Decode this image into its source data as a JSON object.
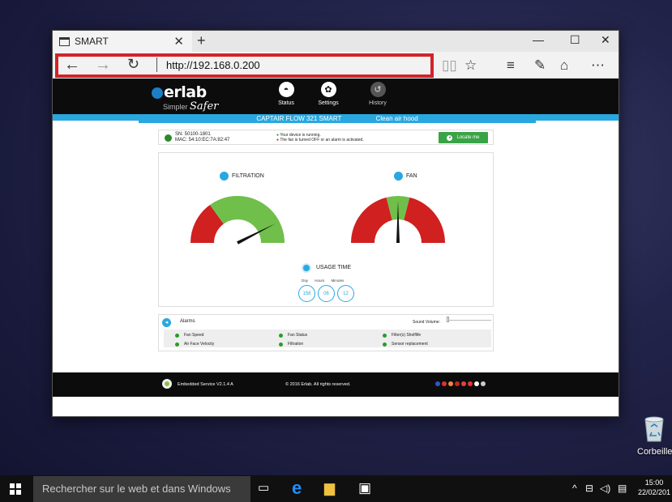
{
  "desktop": {
    "recycle_bin_label": "Corbeille"
  },
  "browser": {
    "tab_title": "SMART",
    "url": "http://192.168.0.200"
  },
  "site": {
    "brand": "erlab",
    "tagline_prefix": "Simpler ",
    "tagline_script": "Safer",
    "nav": [
      {
        "label": "Status",
        "icon": "gauge-icon"
      },
      {
        "label": "Settings",
        "icon": "gear-icon"
      },
      {
        "label": "History",
        "icon": "clock-icon"
      }
    ],
    "device_title": "CAPTAIR FLOW 321 SMART",
    "clean_link": "Clean air hood",
    "sn": "SN: 50100-1801",
    "mac": "MAC: 54:10:EC:7A:82:47",
    "legend_running": "Your device is running.",
    "legend_alarm": "The fan is turned OFF or an alarm is activated.",
    "locate_label": "Locate me",
    "filtration_title": "FILTRATION",
    "fan_title": "FAN",
    "filtration_level": 0.85,
    "fan_level": 0.5,
    "usage_title": "USAGE TIME",
    "usage_units": [
      "Day",
      "Hours",
      "Minutes"
    ],
    "usage_values": [
      "158",
      "06",
      "12"
    ],
    "alarms_title": "Alarms",
    "sound_volume_label": "Sound Volume:",
    "alarm_items": [
      "Fan Speed",
      "Fan Status",
      "Filter(s) Shelflife",
      "Air Face Velocity",
      "Filtration",
      "Sensor replacement"
    ],
    "footer_version": "Embedded Service V2.1.4 A",
    "footer_copyright": "© 2016 Erlab. All rights reserved.",
    "colors": {
      "accent": "#29a8e0",
      "ok": "#3aa346",
      "alarm": "#d02020"
    }
  },
  "taskbar": {
    "search_placeholder": "Rechercher sur le web et dans Windows",
    "time": "15:00",
    "date": "22/02/201"
  }
}
